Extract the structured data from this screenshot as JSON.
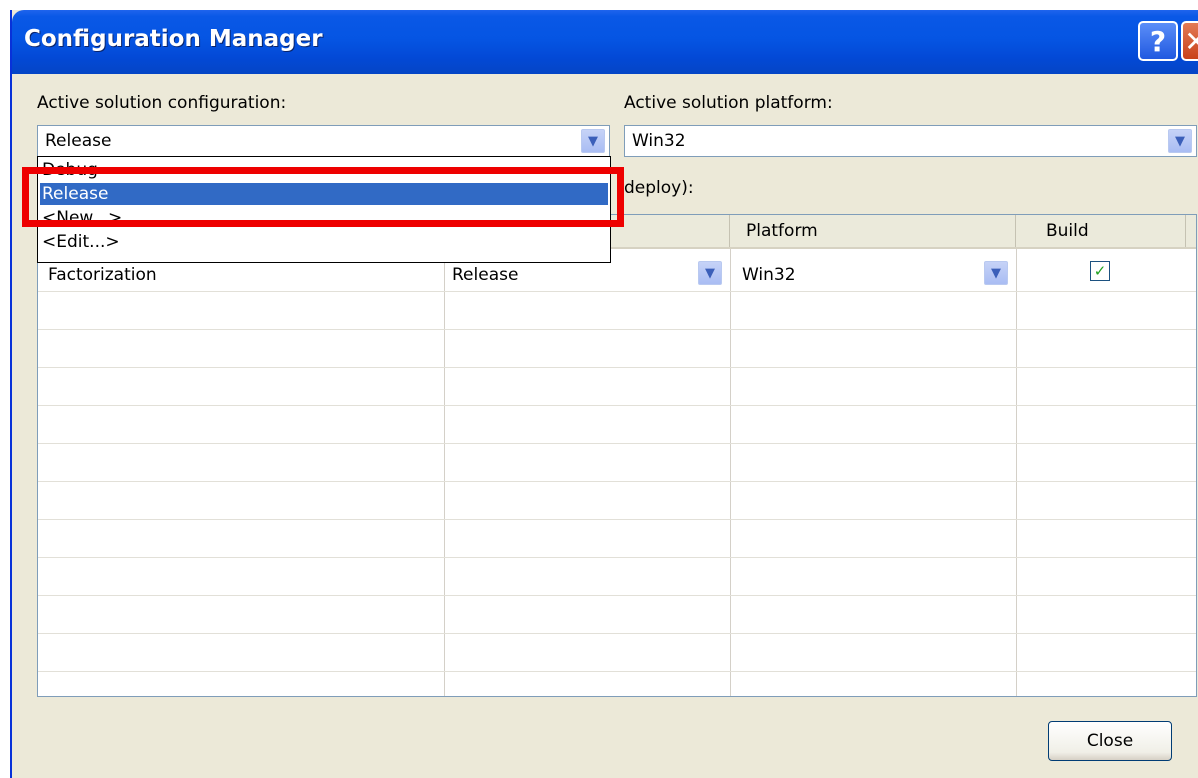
{
  "window": {
    "title": "Configuration Manager",
    "help_glyph": "?",
    "close_glyph": "✕"
  },
  "solution": {
    "config_label": "Active solution configuration:",
    "config_value": "Release",
    "platform_label": "Active solution platform:",
    "platform_value": "Win32"
  },
  "dropdown": {
    "options": [
      "Debug",
      "Release",
      "<New...>",
      "<Edit...>"
    ],
    "selected": "Release"
  },
  "project_contexts": {
    "label_visible_part": "deploy):",
    "columns": [
      "Platform",
      "Build"
    ],
    "rows": [
      {
        "project": "Factorization",
        "configuration": "Release",
        "platform": "Win32",
        "build": true
      }
    ]
  },
  "buttons": {
    "close": "Close"
  },
  "icons": {
    "dropdown_arrow": "chevron-down-icon",
    "check": "check-icon",
    "help": "help-icon",
    "close": "close-icon"
  },
  "colors": {
    "titlebar": "#0555e3",
    "selection": "#316ac5",
    "highlight_box": "#ee0000",
    "dialog_bg": "#ece9d8"
  }
}
